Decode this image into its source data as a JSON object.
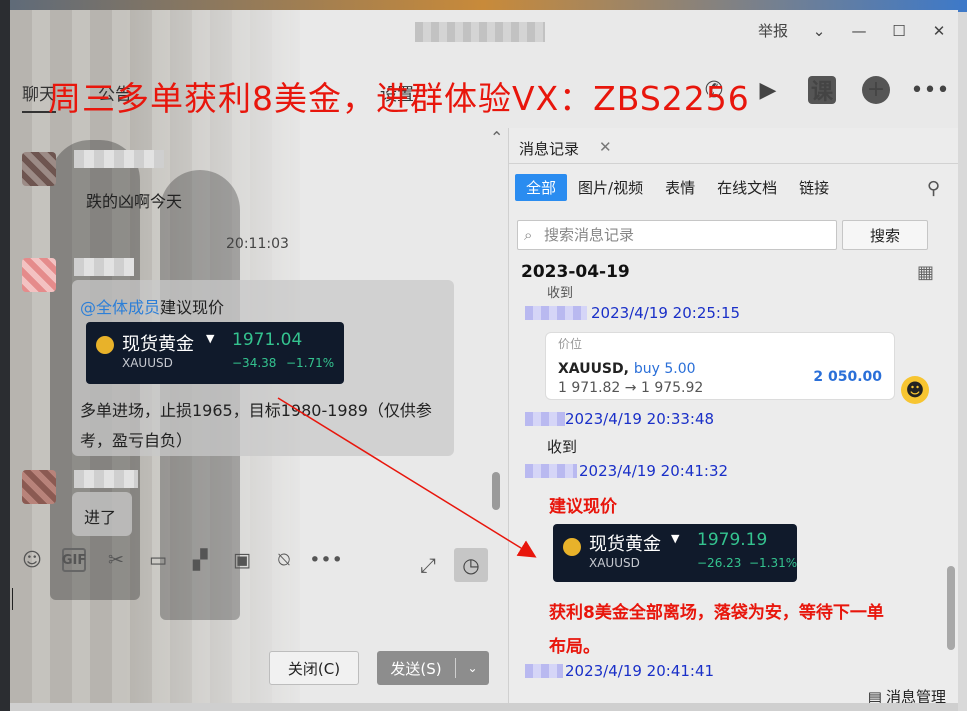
{
  "window": {
    "report_label": "举报"
  },
  "banner": "周三多单获利8美金，进群体验VX：ZBS2256",
  "tabs": [
    "聊天",
    "公告",
    "设置"
  ],
  "toolbar": {
    "lesson_label": "课"
  },
  "chat": {
    "messages": [
      {
        "text": "跌的凶啊今天"
      },
      {
        "time": "20:11:03"
      },
      {
        "mention": "@全体成员",
        "text": "建议现价",
        "card": {
          "name": "现货黄金",
          "symbol": "XAUUSD",
          "price": "1971.04",
          "change": "−34.38",
          "change_pct": "−1.71%"
        },
        "note": "多单进场，止损1965，目标1980-1989（仅供参考，盈亏自负）"
      },
      {
        "text": "进了"
      }
    ],
    "close_label": "关闭(C)",
    "send_label": "发送(S)"
  },
  "history": {
    "tab_label": "消息记录",
    "filters": [
      "全部",
      "图片/视频",
      "表情",
      "在线文档",
      "链接"
    ],
    "search_placeholder": "搜索消息记录",
    "search_button": "搜索",
    "date": "2023-04-19",
    "entries": [
      {
        "text_top": "收到",
        "time": "2023/4/19 20:25:15",
        "trade": {
          "header": "价位",
          "symbol": "XAUUSD,",
          "side": "buy 5.00",
          "prices": "1 971.82 → 1 975.92",
          "value": "2 050.00"
        }
      },
      {
        "time": "2023/4/19 20:33:48",
        "text": "收到"
      },
      {
        "time": "2023/4/19 20:41:32",
        "red": "建议现价",
        "card": {
          "name": "现货黄金",
          "symbol": "XAUUSD",
          "price": "1979.19",
          "change": "−26.23",
          "change_pct": "−1.31%"
        },
        "red_note_line1": "获利8美金全部离场，落袋为安，等待下一单",
        "red_note_line2": "布局。"
      },
      {
        "time": "2023/4/19 20:41:41"
      }
    ],
    "manage_label": "消息管理"
  }
}
